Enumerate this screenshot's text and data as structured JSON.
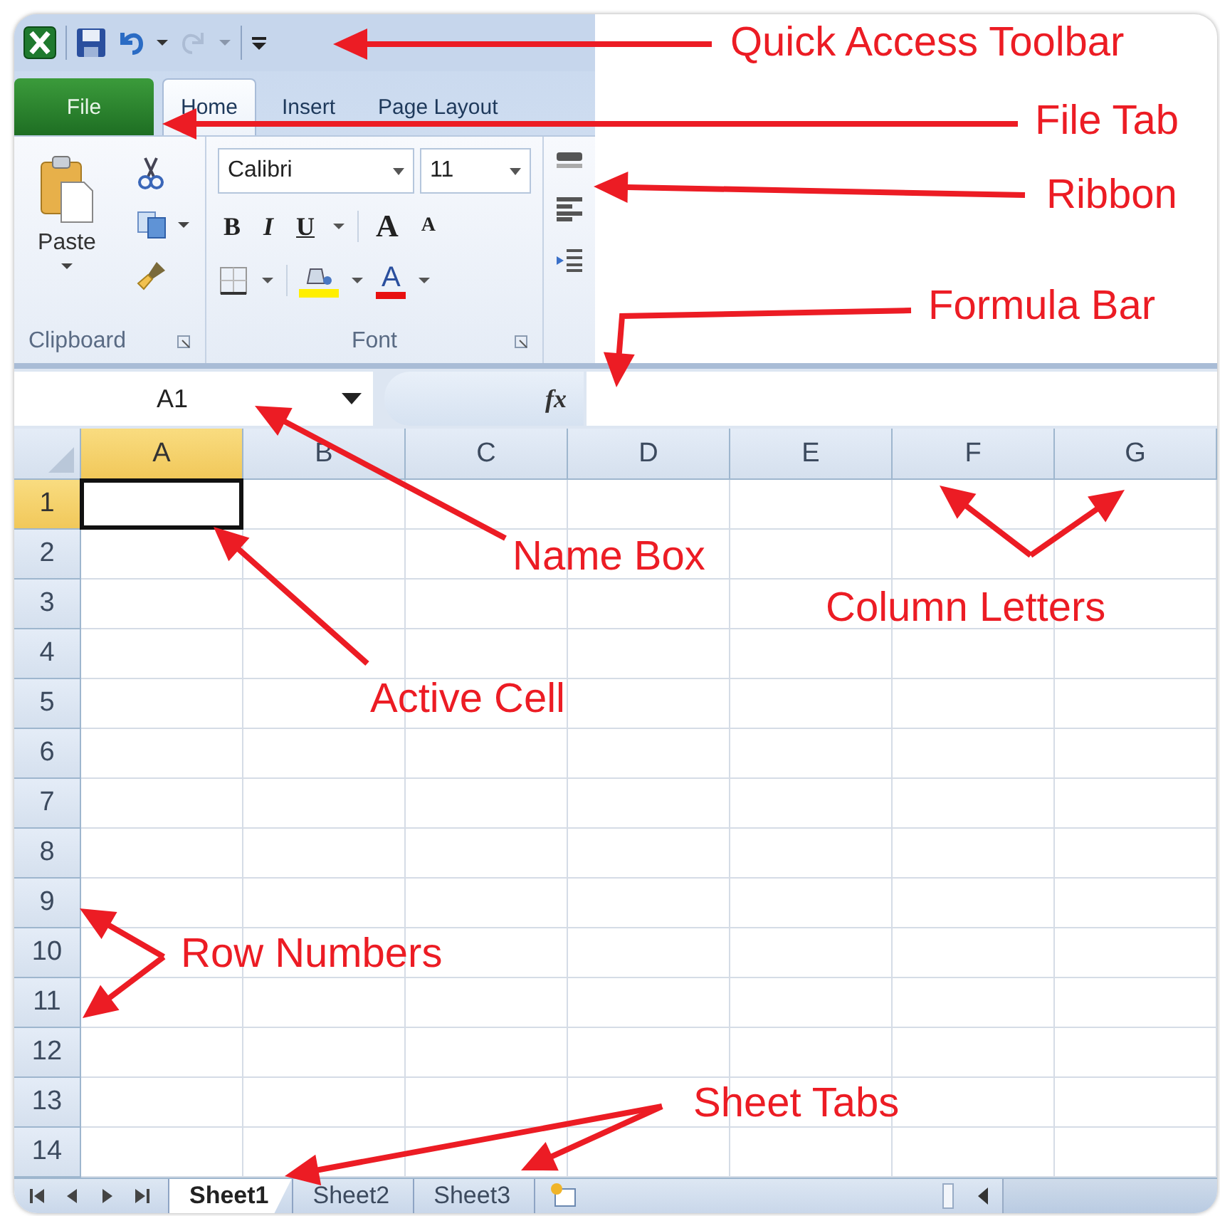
{
  "quick_access_toolbar": {
    "undo_enabled": true,
    "redo_enabled": false
  },
  "tabs": [
    {
      "label": "File",
      "kind": "file",
      "selected": false
    },
    {
      "label": "Home",
      "kind": "tab",
      "selected": true
    },
    {
      "label": "Insert",
      "kind": "tab",
      "selected": false
    },
    {
      "label": "Page Layout",
      "kind": "tab",
      "selected": false
    }
  ],
  "ribbon": {
    "clipboard": {
      "paste_label": "Paste",
      "group_label": "Clipboard"
    },
    "font": {
      "font_name": "Calibri",
      "font_size": "11",
      "bold": "B",
      "italic": "I",
      "underline": "U",
      "grow_font": "A",
      "shrink_font": "A",
      "font_color": "A",
      "group_label": "Font"
    }
  },
  "formula_bar": {
    "name_box": "A1",
    "function_label": "fx"
  },
  "columns": [
    {
      "label": "A",
      "selected": true
    },
    {
      "label": "B",
      "selected": false
    },
    {
      "label": "C",
      "selected": false
    },
    {
      "label": "D",
      "selected": false
    },
    {
      "label": "E",
      "selected": false
    },
    {
      "label": "F",
      "selected": false
    },
    {
      "label": "G",
      "selected": false
    }
  ],
  "rows": [
    {
      "label": "1",
      "selected": true
    },
    {
      "label": "2",
      "selected": false
    },
    {
      "label": "3",
      "selected": false
    },
    {
      "label": "4",
      "selected": false
    },
    {
      "label": "5",
      "selected": false
    },
    {
      "label": "6",
      "selected": false
    },
    {
      "label": "7",
      "selected": false
    },
    {
      "label": "8",
      "selected": false
    },
    {
      "label": "9",
      "selected": false
    },
    {
      "label": "10",
      "selected": false
    },
    {
      "label": "11",
      "selected": false
    },
    {
      "label": "12",
      "selected": false
    },
    {
      "label": "13",
      "selected": false
    },
    {
      "label": "14",
      "selected": false
    }
  ],
  "sheet_tabs": [
    {
      "label": "Sheet1",
      "selected": true
    },
    {
      "label": "Sheet2",
      "selected": false
    },
    {
      "label": "Sheet3",
      "selected": false
    }
  ],
  "annotations": [
    {
      "label": "Quick Access Toolbar"
    },
    {
      "label": "File Tab"
    },
    {
      "label": "Ribbon"
    },
    {
      "label": "Formula Bar"
    },
    {
      "label": "Name Box"
    },
    {
      "label": "Active Cell"
    },
    {
      "label": "Column Letters"
    },
    {
      "label": "Row Numbers"
    },
    {
      "label": "Sheet Tabs"
    }
  ]
}
